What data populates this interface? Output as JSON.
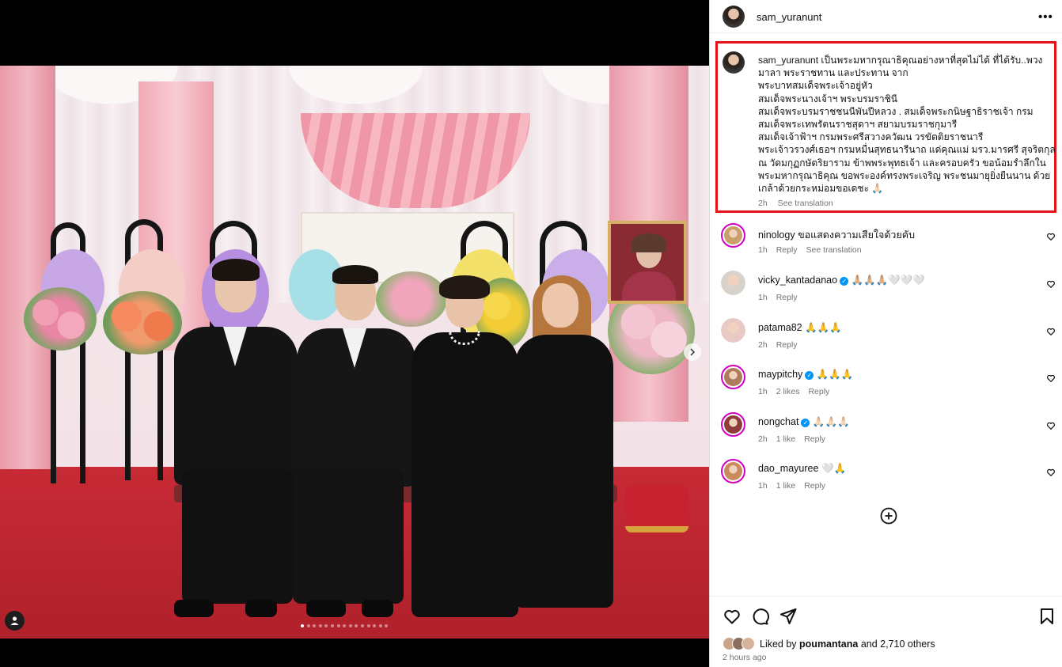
{
  "post": {
    "username": "sam_yuranunt",
    "more_label": "•••"
  },
  "caption": {
    "username": "sam_yuranunt",
    "text": "เป็นพระมหากรุณาธิคุณอย่างหาที่สุดไม่ได้ ที่ได้รับ..พวงมาลา พระราชทาน และประทาน จาก\nพระบาทสมเด็จพระเจ้าอยู่หัว\nสมเด็จพระนางเจ้าฯ พระบรมราชินี\nสมเด็จพระบรมราชชนนีพันปีหลวง . สมเด็จพระกนิษฐาธิราชเจ้า กรมสมเด็จพระเทพรัตนราชสุดาฯ สยามบรมราชกุมารี\nสมเด็จเจ้าฟ้าฯ กรมพระศรีสวางควัฒน วรขัตติยราชนารี\nพระเจ้าวรวงศ์เธอฯ กรมหมื่นสุทธนารีนาถ แด่คุณแม่ มรว.มารศรี สุจริตกุล ณ วัดมกุฏกษัตริยาราม ข้าพพระพุทธเจ้า และครอบครัว ขอน้อมรำลึกในพระมหากรุณาธิคุณ ขอพระองค์ทรงพระเจริญ พระชนมายุยิ่งยืนนาน ด้วยเกล้าด้วยกระหม่อมขอเดชะ 🙏🏻",
    "time": "2h",
    "see_translation": "See translation"
  },
  "comments": [
    {
      "username": "ninology",
      "text": "ขอแสดงความเสียใจด้วยคับ",
      "verified": false,
      "time": "1h",
      "likes": "",
      "reply": "Reply",
      "translate": "See translation",
      "avatar_color": "#c9a06a"
    },
    {
      "username": "vicky_kantadanao",
      "text": "🙏🏼🙏🏼🙏🏼🤍🤍🤍",
      "verified": true,
      "time": "1h",
      "likes": "",
      "reply": "Reply",
      "translate": "",
      "avatar_color": "#d8d2cc"
    },
    {
      "username": "patama82",
      "text": "🙏🙏🙏",
      "verified": false,
      "time": "2h",
      "likes": "",
      "reply": "Reply",
      "translate": "",
      "avatar_color": "#e9c9c4"
    },
    {
      "username": "maypitchy",
      "text": "🙏🙏🙏",
      "verified": true,
      "time": "1h",
      "likes": "2 likes",
      "reply": "Reply",
      "translate": "",
      "avatar_color": "#b07a5c"
    },
    {
      "username": "nongchat",
      "text": "🙏🏻🙏🏻🙏🏻",
      "verified": true,
      "time": "2h",
      "likes": "1 like",
      "reply": "Reply",
      "translate": "",
      "avatar_color": "#8e3b3b"
    },
    {
      "username": "dao_mayuree",
      "text": "🤍🙏",
      "verified": false,
      "time": "1h",
      "likes": "1 like",
      "reply": "Reply",
      "translate": "",
      "avatar_color": "#c98a5c"
    }
  ],
  "footer": {
    "liked_prefix": "Liked by ",
    "liked_user": "poumantana",
    "liked_suffix": " and 2,710 others",
    "time_ago": "2 hours ago"
  },
  "colors": {
    "highlight_border": "#e3121b",
    "verified_blue": "#0095f6",
    "story_ring": "#d300c5"
  },
  "carousel": {
    "total": 15,
    "active": 1
  }
}
